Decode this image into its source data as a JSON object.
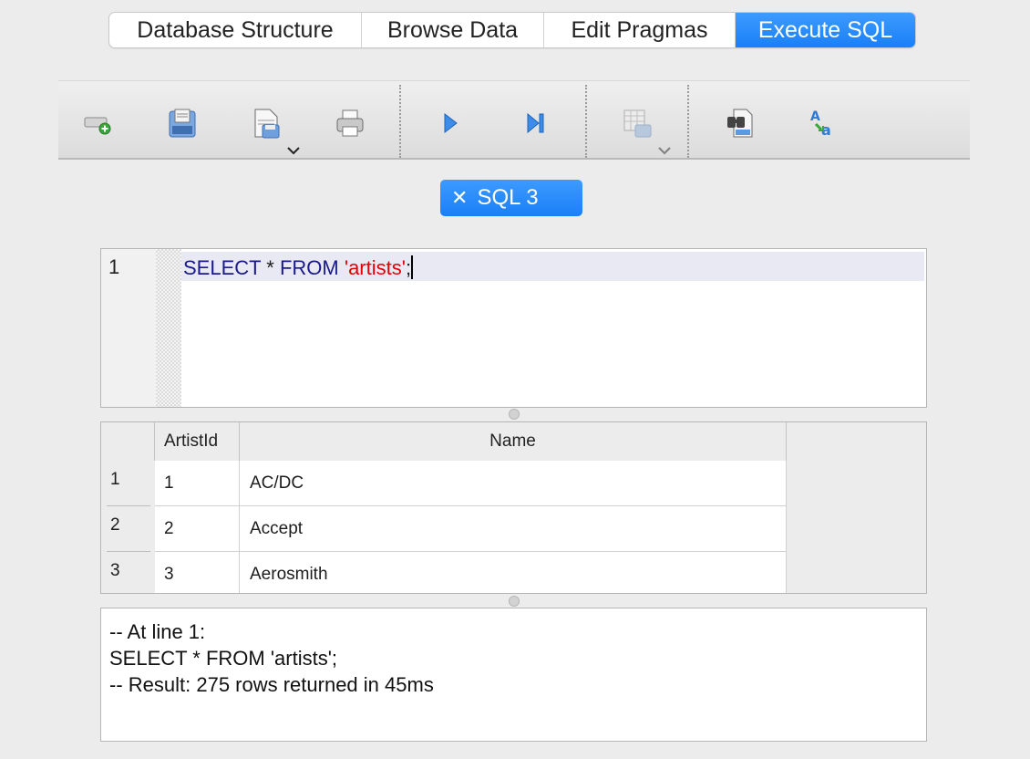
{
  "tabs": [
    {
      "label": "Database Structure",
      "active": false
    },
    {
      "label": "Browse Data",
      "active": false
    },
    {
      "label": "Edit Pragmas",
      "active": false
    },
    {
      "label": "Execute SQL",
      "active": true
    }
  ],
  "toolbar": {
    "buttons": [
      {
        "icon": "open-tab-icon"
      },
      {
        "icon": "open-sql-file-icon"
      },
      {
        "icon": "save-sql-file-icon",
        "has_dropdown": true
      },
      {
        "icon": "print-icon"
      },
      {
        "icon": "execute-all-icon"
      },
      {
        "icon": "execute-current-line-icon"
      },
      {
        "icon": "save-results-icon",
        "has_dropdown": true,
        "disabled": true
      },
      {
        "icon": "find-icon"
      },
      {
        "icon": "find-replace-icon"
      }
    ]
  },
  "sql_tab": {
    "close_glyph": "✕",
    "label": "SQL 3"
  },
  "editor": {
    "line_number": "1",
    "tokens": {
      "select": "SELECT",
      "star": " * ",
      "from": "FROM",
      "space": " ",
      "table": "'artists'",
      "semicolon": ";"
    }
  },
  "results": {
    "columns": [
      "ArtistId",
      "Name"
    ],
    "rows": [
      {
        "num": "1",
        "id": "1",
        "name": "AC/DC"
      },
      {
        "num": "2",
        "id": "2",
        "name": "Accept"
      },
      {
        "num": "3",
        "id": "3",
        "name": "Aerosmith"
      }
    ]
  },
  "messages": {
    "line1": "-- At line 1:",
    "line2": "SELECT * FROM 'artists';",
    "line3": "-- Result: 275 rows returned in 45ms"
  },
  "colors": {
    "accent": "#1a7ff7",
    "keyword": "#1a1a8c",
    "string": "#e00000"
  }
}
